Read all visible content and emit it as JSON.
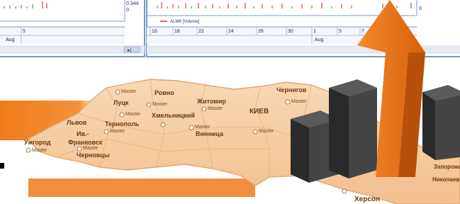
{
  "chart_windows": {
    "left": {
      "price_label": "0.344",
      "zero_label": "0",
      "date_ticks": [
        "5"
      ],
      "month_label": "Aug"
    },
    "right": {
      "zero_label": "0",
      "legend": "ALMK [Volume]",
      "date_ticks": [
        "16",
        "18",
        "22",
        "24",
        "26",
        "30",
        "1",
        "5",
        "7"
      ],
      "month_label": "Aug"
    }
  },
  "map": {
    "regions": [
      "Ровно",
      "Житомир",
      "Луцк",
      "КИЕВ",
      "Чернигов",
      "Хмельницкий",
      "Тернополь",
      "Львов",
      "Ив.-",
      "Франковск",
      "Ужгород",
      "Черновцы",
      "Винница",
      "Херсон",
      "Николаев",
      "Запорожье"
    ],
    "pin_label": "Master"
  },
  "colors": {
    "accent_orange": "#f07a1a",
    "map_fill": "#f6d3ae",
    "bar_dark": "#3a3a3a",
    "window_border": "#7a96c8"
  }
}
